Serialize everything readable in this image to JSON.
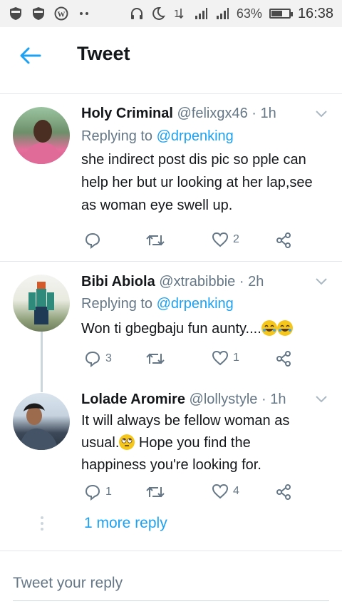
{
  "status_bar": {
    "battery_percent": "63%",
    "battery_level": 0.63,
    "time": "16:38",
    "icons": [
      "shield-icon",
      "shield-icon",
      "wordpress-icon",
      "dots-icon",
      "headset-icon",
      "moon-icon",
      "data-arrows-icon",
      "signal-icon",
      "signal-icon",
      "battery-icon"
    ]
  },
  "header": {
    "title": "Tweet",
    "back_icon": "arrow-left-icon"
  },
  "colors": {
    "link": "#1da1f2",
    "muted": "#657786",
    "divider": "#e1e8ed"
  },
  "tweets": [
    {
      "name": "Holy Criminal",
      "handle": "@felixgx46",
      "time": " · 1h",
      "replying_prefix": "Replying to ",
      "replying_to": "@drpenking",
      "lines": [
        "she indirect post dis pic so pple can",
        "help her but ur looking at her lap,see",
        "as woman eye swell up."
      ],
      "replies": "",
      "likes": "2"
    },
    {
      "name": "Bibi Abiola",
      "handle": "@xtrabibbie",
      "time": " · 2h",
      "replying_prefix": "Replying to ",
      "replying_to": "@drpenking",
      "lines": [
        "Won ti gbegbaju fun aunty...."
      ],
      "emoji": [
        "rofl-emoji",
        "rofl-emoji"
      ],
      "replies": "3",
      "likes": "1"
    },
    {
      "name": "Lolade Aromire",
      "handle": "@lollystyle",
      "time": " · 1h",
      "lines": [
        "It will always be fellow woman as",
        "usual.",
        " Hope you find the",
        "happiness you're looking for."
      ],
      "emoji": [
        "eye-roll-emoji"
      ],
      "replies": "1",
      "likes": "4"
    }
  ],
  "more_reply": "1 more reply",
  "reply_placeholder": "Tweet your reply"
}
